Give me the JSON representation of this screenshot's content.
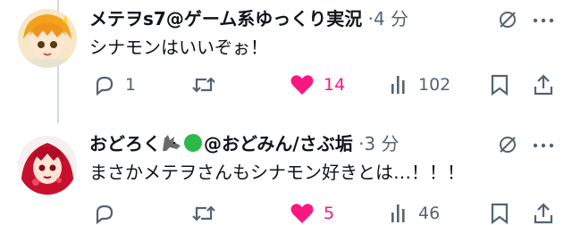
{
  "posts": [
    {
      "display_name": "メテヲs7@ゲーム系ゆっくり実況",
      "time": "·4 分",
      "text": "シナモンはいいぞぉ！",
      "reply_count": "1",
      "retweet_count": "",
      "like_count": "14",
      "view_count": "102",
      "liked": true
    },
    {
      "display_name_prefix": "おどろく",
      "display_name_suffix": "@おどみん/さぶ垢",
      "time": "·3 分",
      "text": "まさかメテヲさんもシナモン好きとは…！！！",
      "reply_count": "",
      "like_count": "5",
      "view_count": "46",
      "liked": true
    }
  ],
  "colors": {
    "like": "#f91880",
    "muted": "#536471",
    "line": "#cfd9de",
    "text": "#0f1419"
  },
  "icons": [
    "grok-icon",
    "more-icon",
    "reply-icon",
    "retweet-icon",
    "heart-icon",
    "views-icon",
    "bookmark-icon",
    "share-icon",
    "wolf-emoji",
    "green-circle-emoji"
  ]
}
